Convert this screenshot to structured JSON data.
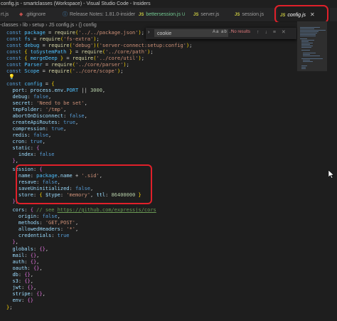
{
  "title_bar": {
    "text": "config.js - smartclasses (Workspace) - Visual Studio Code - Insiders"
  },
  "tabs": [
    {
      "label": "rt.js",
      "icon": "js",
      "state": ""
    },
    {
      "label": ".gitignore",
      "icon": "git",
      "state": ""
    },
    {
      "label": "Release Notes: 1.81.0-insider",
      "icon": "info",
      "state": ""
    },
    {
      "label": "bettersession.js",
      "icon": "js",
      "state": "U"
    },
    {
      "label": "server.js",
      "icon": "js",
      "state": ""
    },
    {
      "label": "session.js",
      "icon": "js",
      "state": ""
    },
    {
      "label": "config.js",
      "icon": "js",
      "state": "active"
    }
  ],
  "tab_js_badge": "JS",
  "tab_close_glyph": "✕",
  "breadcrumb": {
    "text": "-classes › lib › setup › JS config.js › {} config"
  },
  "find_widget": {
    "value": "cookie",
    "options": "Aa  ab  .*",
    "result": "No results",
    "nav": "↑ ↓ ≡ ✕"
  },
  "code_lines": [
    "const package = require('../../package.json');",
    "const fs = require('fs-extra');",
    "const debug = require('debug')('server-connect:setup:config');",
    "const { toSystemPath } = require('../core/path');",
    "const { mergeDeep } = require('../core/util');",
    "const Parser = require('../core/parser');",
    "const Scope = require('../core/scope');",
    "",
    "const config = {",
    "  port: process.env.PORT || 3000,",
    "  debug: false,",
    "  secret: 'Need to be set',",
    "  tmpFolder: '/tmp',",
    "  abortOnDisconnect: false,",
    "  createApiRoutes: true,",
    "  compression: true,",
    "  redis: false,",
    "  cron: true,",
    "  static: {",
    "    index: false",
    "  },",
    "  session: {",
    "    name: package.name + '.sid',",
    "    resave: false,",
    "    saveUninitialized: false,",
    "    store: { $type: 'memory', ttl: 86400000 }",
    "  },",
    "  cors: { // see https://github.com/expressjs/cors",
    "    origin: false,",
    "    methods: 'GET,POST',",
    "    allowedHeaders: '*',",
    "    credentials: true",
    "  },",
    "  globals: {},",
    "  mail: {},",
    "  auth: {},",
    "  oauth: {},",
    "  db: {},",
    "  s3: {},",
    "  jwt: {},",
    "  stripe: {},",
    "  env: {}",
    "};"
  ],
  "colors": {
    "highlight": "#e0202a",
    "keyword": "#569cd6",
    "string": "#ce9178",
    "number": "#b5cea8"
  }
}
